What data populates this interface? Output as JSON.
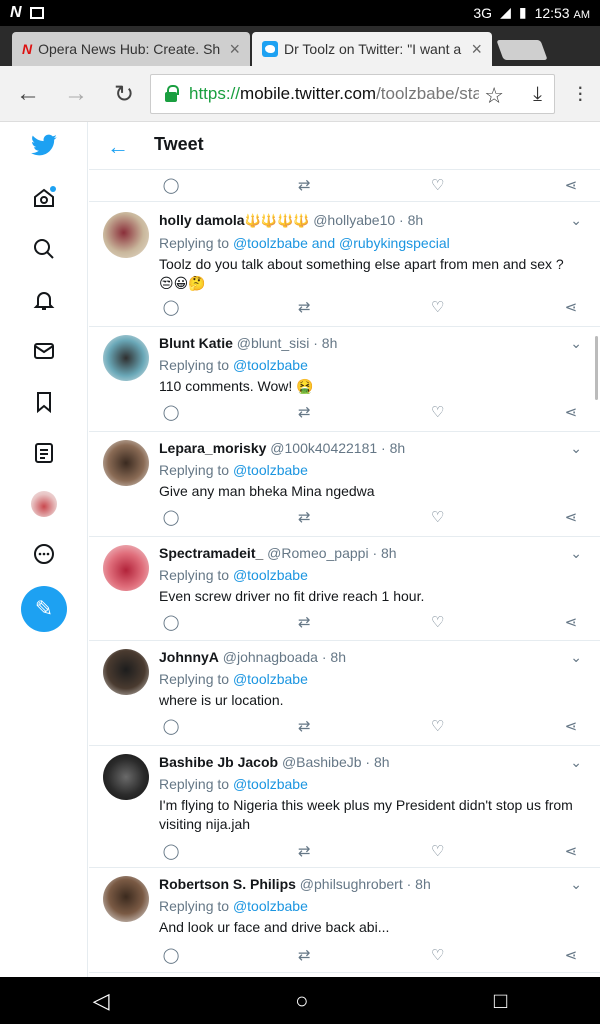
{
  "status": {
    "network": "3G",
    "time": "12:53",
    "ampm": "AM"
  },
  "tabs": [
    {
      "title": "Opera News Hub: Create. Sh",
      "close": "×"
    },
    {
      "title": "Dr Toolz on Twitter: \"I want a",
      "close": "×"
    }
  ],
  "address": {
    "scheme": "https://",
    "host": "mobile.twitter.com",
    "path": "/toolzbabe/sta"
  },
  "header": {
    "title": "Tweet"
  },
  "tweets": [
    {
      "name": "holly damola",
      "emoji": "🔱🔱🔱🔱",
      "handle": "@hollyabe10",
      "time": "· 8h",
      "replying": "Replying to",
      "to": "@toolzbabe and @rubykingspecial",
      "text": "Toolz do you talk about something else apart from men and sex ?",
      "text_emoji": "😒😀🤔"
    },
    {
      "name": "Blunt Katie",
      "handle": "@blunt_sisi",
      "time": "· 8h",
      "replying": "Replying to",
      "to": "@toolzbabe",
      "text": "110 comments. Wow! 🤮"
    },
    {
      "name": "Lepara_morisky",
      "handle": "@100k40422181",
      "time": "· 8h",
      "replying": "Replying to",
      "to": "@toolzbabe",
      "text": "Give any man bheka Mina ngedwa"
    },
    {
      "name": "Spectramadeit_",
      "handle": "@Romeo_pappi",
      "time": "· 8h",
      "replying": "Replying to",
      "to": "@toolzbabe",
      "text": "Even screw driver no fit drive reach 1 hour."
    },
    {
      "name": "JohnnyA",
      "handle": "@johnagboada",
      "time": "· 8h",
      "replying": "Replying to",
      "to": "@toolzbabe",
      "text": "where is ur location."
    },
    {
      "name": "Bashibe Jb Jacob",
      "handle": "@BashibeJb",
      "time": "· 8h",
      "replying": "Replying to",
      "to": "@toolzbabe",
      "text": "I'm flying to Nigeria this week plus my President didn't stop us from visiting nija.jah"
    },
    {
      "name": "Robertson S. Philips",
      "handle": "@philsughrobert",
      "time": "· 8h",
      "replying": "Replying to",
      "to": "@toolzbabe",
      "text": "And look ur face and drive back abi..."
    }
  ],
  "colors": {
    "accent": "#1da1f2",
    "link": "#1b95e0",
    "muted": "#657786"
  }
}
